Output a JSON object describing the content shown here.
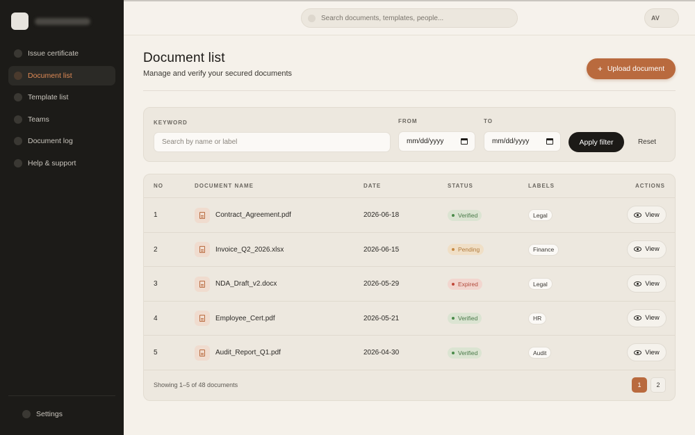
{
  "sidebar": {
    "items": [
      {
        "label": "Issue certificate",
        "icon": "certificate-icon",
        "active": false
      },
      {
        "label": "Document list",
        "icon": "document-icon",
        "active": true
      },
      {
        "label": "Template list",
        "icon": "template-icon",
        "active": false
      },
      {
        "label": "Teams",
        "icon": "team-icon",
        "active": false
      },
      {
        "label": "Document log",
        "icon": "log-icon",
        "active": false
      },
      {
        "label": "Help & support",
        "icon": "help-icon",
        "active": false
      }
    ],
    "settings_label": "Settings"
  },
  "topbar": {
    "search_placeholder": "Search documents, templates, people...",
    "avatar_initials": "AV"
  },
  "header": {
    "title": "Document list",
    "subtitle": "Manage and verify your secured documents",
    "upload_label": "Upload document"
  },
  "filters": {
    "keyword_label": "KEYWORD",
    "keyword_placeholder": "Search by name or label",
    "from_label": "FROM",
    "from_value": "mm/dd/yyyy",
    "to_label": "TO",
    "to_value": "mm/dd/yyyy",
    "apply_label": "Apply filter",
    "reset_label": "Reset"
  },
  "table": {
    "columns": [
      "NO",
      "DOCUMENT NAME",
      "DATE",
      "STATUS",
      "LABELS",
      "ACTIONS"
    ],
    "view_label": "View",
    "rows": [
      {
        "no": "1",
        "name": "Contract_Agreement.pdf",
        "date": "2026-06-18",
        "status": "Verified",
        "label": "Legal"
      },
      {
        "no": "2",
        "name": "Invoice_Q2_2026.xlsx",
        "date": "2026-06-15",
        "status": "Pending",
        "label": "Finance"
      },
      {
        "no": "3",
        "name": "NDA_Draft_v2.docx",
        "date": "2026-05-29",
        "status": "Expired",
        "label": "Legal"
      },
      {
        "no": "4",
        "name": "Employee_Cert.pdf",
        "date": "2026-05-21",
        "status": "Verified",
        "label": "HR"
      },
      {
        "no": "5",
        "name": "Audit_Report_Q1.pdf",
        "date": "2026-04-30",
        "status": "Verified",
        "label": "Audit"
      }
    ],
    "footer_text": "Showing 1–5 of 48 documents",
    "pages": [
      "1",
      "2"
    ]
  },
  "colors": {
    "accent": "#b96a3e",
    "sidebar_bg": "#1c1b18",
    "page_bg": "#f5f1ea",
    "verified": "#4a8a49",
    "pending": "#c68a44",
    "expired": "#c0483a"
  }
}
